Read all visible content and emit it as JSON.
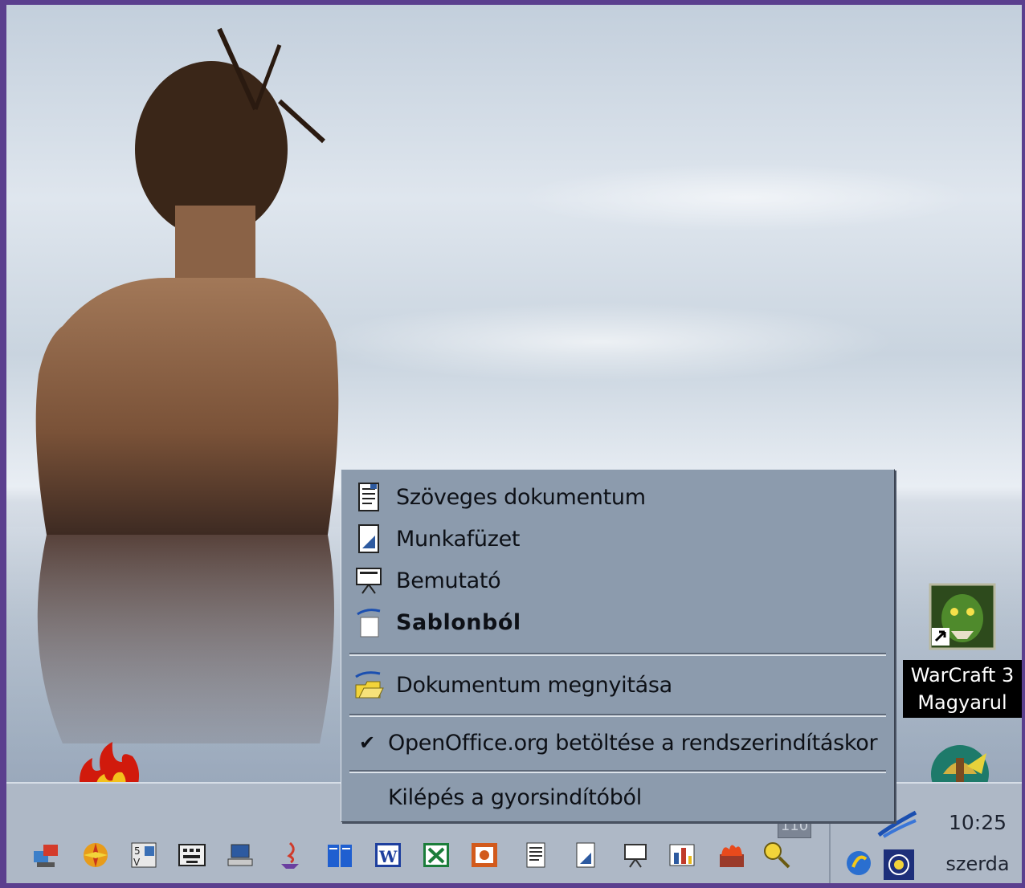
{
  "menu": {
    "items": [
      {
        "label": "Szöveges dokumentum",
        "icon": "writer-document-icon"
      },
      {
        "label": "Munkafüzet",
        "icon": "calc-spreadsheet-icon"
      },
      {
        "label": "Bemutató",
        "icon": "impress-presentation-icon"
      },
      {
        "label": "Sablonból",
        "icon": "template-icon",
        "bold": true
      },
      {
        "label": "Dokumentum megnyitása",
        "icon": "open-folder-icon"
      },
      {
        "label": "OpenOffice.org betöltése a rendszerindításkor",
        "checked": true
      },
      {
        "label": "Kilépés a gyorsindítóból"
      }
    ]
  },
  "desktop": {
    "icon_label_line1": "WarCraft 3",
    "icon_label_line2": "Magyarul"
  },
  "taskbar": {
    "time": "10:25",
    "day": "szerda",
    "mini_label": "110",
    "quicklaunch": [
      "network-icon",
      "pinwheel-icon",
      "sv-app-icon",
      "keyboard-icon",
      "computer-icon",
      "java-icon",
      "book-icon",
      "word-icon",
      "excel-icon",
      "powerpoint-icon",
      "writer-icon",
      "calc-icon",
      "impress-icon",
      "chart-icon",
      "firewall-icon",
      "search-key-icon"
    ]
  },
  "colors": {
    "frame": "#5b3f8e",
    "menu_bg": "#8c9bad",
    "taskbar_bg": "#aeb8c6"
  }
}
